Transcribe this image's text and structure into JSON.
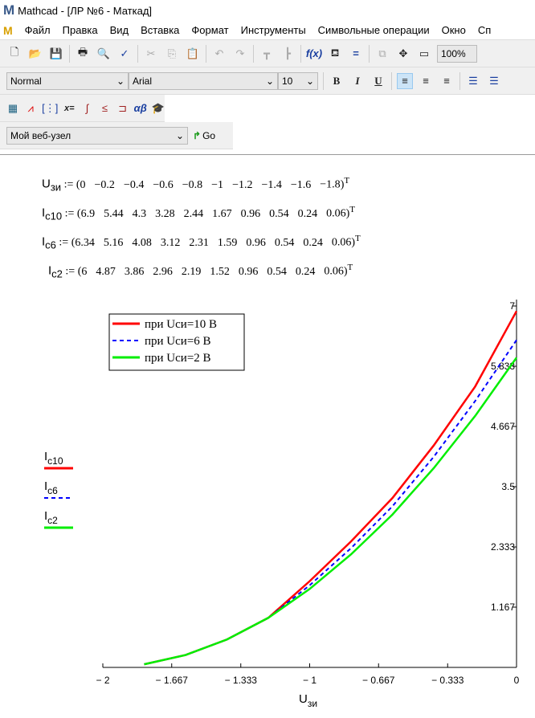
{
  "window": {
    "title": "Mathcad - [ЛР №6 - Маткад]",
    "logo": "M"
  },
  "menu": [
    "Файл",
    "Правка",
    "Вид",
    "Вставка",
    "Формат",
    "Инструменты",
    "Символьные операции",
    "Окно",
    "Сп"
  ],
  "toolbar": {
    "zoom": "100%"
  },
  "format": {
    "style": "Normal",
    "font": "Arial",
    "size": "10"
  },
  "web": {
    "site": "Мой веб-узел",
    "go": "Go"
  },
  "equations": [
    {
      "name": "U",
      "sub": "зи",
      "values": [
        "0",
        "−0.2",
        "−0.4",
        "−0.6",
        "−0.8",
        "−1",
        "−1.2",
        "−1.4",
        "−1.6",
        "−1.8"
      ]
    },
    {
      "name": "I",
      "sub": "c10",
      "values": [
        "6.9",
        "5.44",
        "4.3",
        "3.28",
        "2.44",
        "1.67",
        "0.96",
        "0.54",
        "0.24",
        "0.06"
      ]
    },
    {
      "name": "I",
      "sub": "c6",
      "values": [
        "6.34",
        "5.16",
        "4.08",
        "3.12",
        "2.31",
        "1.59",
        "0.96",
        "0.54",
        "0.24",
        "0.06"
      ]
    },
    {
      "name": "I",
      "sub": "c2",
      "values": [
        "6",
        "4.87",
        "3.86",
        "2.96",
        "2.19",
        "1.52",
        "0.96",
        "0.54",
        "0.24",
        "0.06"
      ]
    }
  ],
  "assign": ":=",
  "transpose": "T",
  "chart_data": {
    "type": "line",
    "x": [
      0,
      -0.2,
      -0.4,
      -0.6,
      -0.8,
      -1,
      -1.2,
      -1.4,
      -1.6,
      -1.8
    ],
    "series": [
      {
        "name": "при Uси=10 В",
        "trace": "Ic10",
        "trace_sub": "c10",
        "color": "#ff0000",
        "dash": "solid",
        "values": [
          6.9,
          5.44,
          4.3,
          3.28,
          2.44,
          1.67,
          0.96,
          0.54,
          0.24,
          0.06
        ]
      },
      {
        "name": "при Uси=6 В",
        "trace": "Ic6",
        "trace_sub": "c6",
        "color": "#0000ff",
        "dash": "dashed",
        "values": [
          6.34,
          5.16,
          4.08,
          3.12,
          2.31,
          1.59,
          0.96,
          0.54,
          0.24,
          0.06
        ]
      },
      {
        "name": "при Uси=2 В",
        "trace": "Ic2",
        "trace_sub": "c2",
        "color": "#00ee00",
        "dash": "solid",
        "values": [
          6,
          4.87,
          3.86,
          2.96,
          2.19,
          1.52,
          0.96,
          0.54,
          0.24,
          0.06
        ]
      }
    ],
    "xlabel": "U",
    "xlabel_sub": "зи",
    "xlim": [
      -2,
      0
    ],
    "ylim": [
      0,
      7
    ],
    "xticks": [
      "− 2",
      "− 1.667",
      "− 1.333",
      "− 1",
      "− 0.667",
      "− 0.333",
      "0"
    ],
    "xtick_values": [
      -2,
      -1.667,
      -1.333,
      -1,
      -0.667,
      -0.333,
      0
    ],
    "yticks": [
      "1.167",
      "2.333",
      "3.5",
      "4.667",
      "5.833",
      "7"
    ],
    "ytick_values": [
      1.167,
      2.333,
      3.5,
      4.667,
      5.833,
      7
    ],
    "legend": "top-left"
  }
}
